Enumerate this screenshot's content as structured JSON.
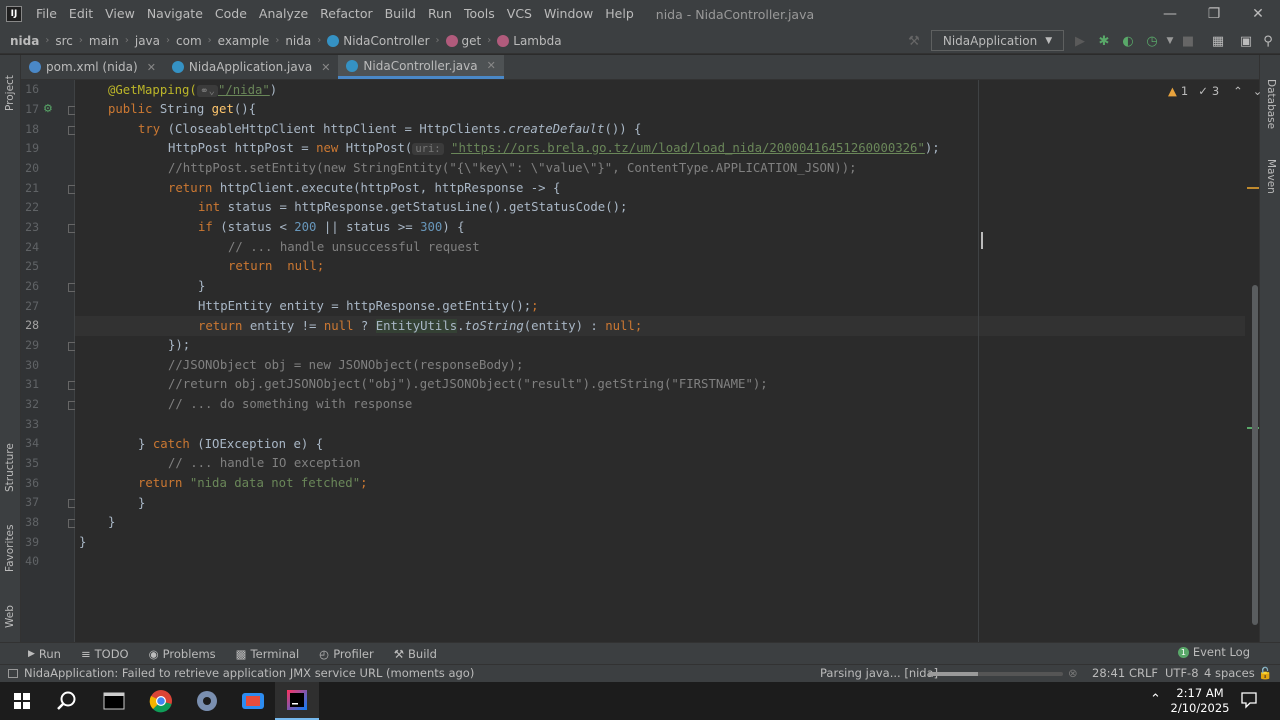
{
  "menu": [
    "File",
    "Edit",
    "View",
    "Navigate",
    "Code",
    "Analyze",
    "Refactor",
    "Build",
    "Run",
    "Tools",
    "VCS",
    "Window",
    "Help"
  ],
  "window_title": "nida - NidaController.java",
  "breadcrumbs": [
    "nida",
    "src",
    "main",
    "java",
    "com",
    "example",
    "nida",
    "NidaController",
    "get",
    "Lambda"
  ],
  "run_config": "NidaApplication",
  "tabs": [
    {
      "label": "pom.xml (nida)",
      "icon_color": "#4a88c7"
    },
    {
      "label": "NidaApplication.java",
      "icon_color": "#3592c4"
    },
    {
      "label": "NidaController.java",
      "icon_color": "#3592c4"
    }
  ],
  "left_tools": [
    "Project",
    "Structure",
    "Favorites",
    "Web"
  ],
  "right_tools": [
    "Database",
    "Maven"
  ],
  "inspection": {
    "warnings": "1",
    "weak_warnings": "3"
  },
  "line_numbers": [
    "16",
    "17",
    "18",
    "19",
    "20",
    "21",
    "22",
    "23",
    "24",
    "25",
    "26",
    "27",
    "28",
    "29",
    "30",
    "31",
    "32",
    "33",
    "34",
    "35",
    "36",
    "37",
    "38",
    "39",
    "40"
  ],
  "current_line": "28",
  "code": {
    "l16_ann": "@GetMapping(",
    "l16_path": "\"/nida\"",
    "l16_end": ")",
    "l17_kw": "public",
    "l17_rest": " String ",
    "l17_m": "get",
    "l17_end": "(){",
    "l18_kw": "try",
    "l18_a": " (CloseableHttpClient httpClient = HttpClients.",
    "l18_m": "createDefault",
    "l18_b": "()) {",
    "l19_a": "HttpPost httpPost = ",
    "l19_kw": "new",
    "l19_b": " HttpPost(",
    "l19_hint": "uri:",
    "l19_url": "\"https://ors.brela.go.tz/um/load/load_nida/20000416451260000326\"",
    "l19_end": ");",
    "l20_cmt": "//httpPost.setEntity(new StringEntity(\"{\\\"key\\\": \\\"value\\\"}\", ContentType.APPLICATION_JSON));",
    "l21_kw": "return",
    "l21_rest": " httpClient.execute(httpPost, httpResponse -> {",
    "l22_kw": "int",
    "l22_rest": " status = httpResponse.getStatusLine().getStatusCode();",
    "l23_kw": "if",
    "l23_a": " (status < ",
    "l23_n1": "200",
    "l23_b": " || status >= ",
    "l23_n2": "300",
    "l23_c": ") {",
    "l24_cmt": "// ... handle unsuccessful request",
    "l25_kw": "return",
    "l25_null": "  null",
    "l25_end": ";",
    "l26": "}",
    "l27": "HttpEntity entity = httpResponse.getEntity();",
    "l28_kw": "return",
    "l28_a": " entity != ",
    "l28_null": "null",
    "l28_b": " ? ",
    "l28_cls": "EntityUtils",
    "l28_dot": ".",
    "l28_m": "toString",
    "l28_c": "(entity) : ",
    "l28_null2": "null",
    "l28_end": ";",
    "l29": "});",
    "l30_cmt": "//JSONObject obj = new JSONObject(responseBody);",
    "l31_cmt": "//return obj.getJSONObject(\"obj\").getJSONObject(\"result\").getString(\"FIRSTNAME\");",
    "l32_cmt": "// ... do something with response",
    "l34_a": "} ",
    "l34_kw": "catch",
    "l34_b": " (IOException e) {",
    "l35_cmt": "// ... handle IO exception",
    "l36_kw": "return",
    "l36_str": " \"nida data not fetched\"",
    "l36_end": ";",
    "l37": "}",
    "l38": "}",
    "l39": "}"
  },
  "bottom_tools": [
    "Run",
    "TODO",
    "Problems",
    "Terminal",
    "Profiler",
    "Build"
  ],
  "event_log": "Event Log",
  "status": {
    "message": "NidaApplication: Failed to retrieve application JMX service URL (moments ago)",
    "parsing": "Parsing java... [nida]",
    "progress": 0.37,
    "position": "28:41",
    "line_sep": "CRLF",
    "encoding": "UTF-8",
    "indent": "4 spaces"
  },
  "clock": {
    "time": "2:17 AM",
    "date": "2/10/2025"
  }
}
